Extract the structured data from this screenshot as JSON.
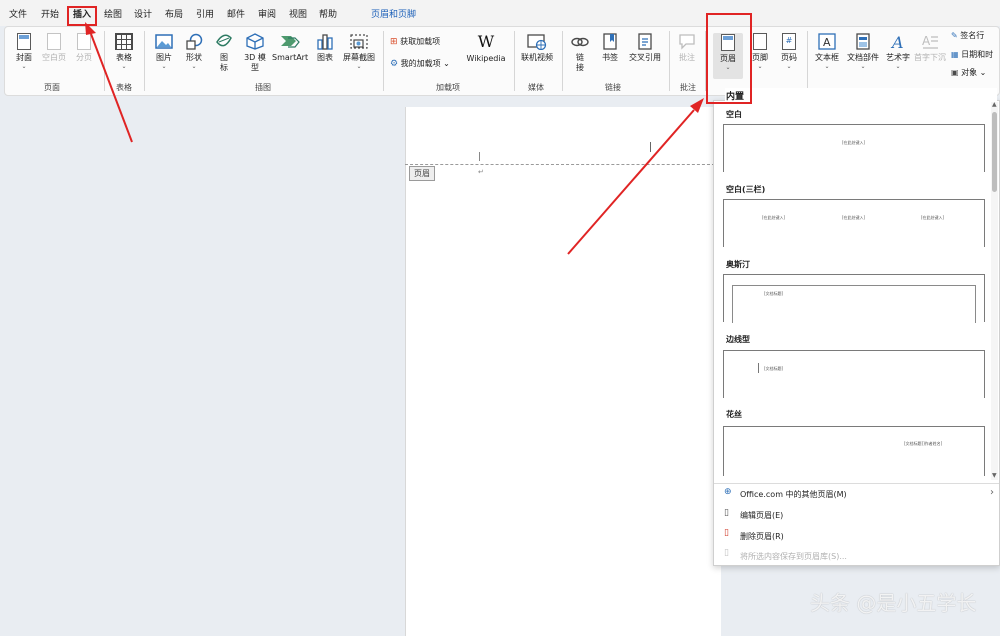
{
  "menu": {
    "tabs": [
      "文件",
      "开始",
      "插入",
      "绘图",
      "设计",
      "布局",
      "引用",
      "邮件",
      "审阅",
      "视图",
      "帮助"
    ],
    "context_tab": "页眉和页脚",
    "active_tab": "插入"
  },
  "ribbon": {
    "pages": {
      "group": "页面",
      "cover": "封面",
      "blank_page": "空白页",
      "page_break": "分页"
    },
    "tables": {
      "group": "表格",
      "table": "表格"
    },
    "illustrations": {
      "group": "插图",
      "picture": "图片",
      "shape": "形状",
      "icon_1": "图",
      "icon_2": "标",
      "model_1": "3D 模",
      "model_2": "型",
      "smartart": "SmartArt",
      "chart": "图表",
      "screenshot": "屏幕截图"
    },
    "addins": {
      "group": "加载项",
      "get_addins": "获取加载项",
      "my_addins": "我的加载项",
      "wikipedia": "Wikipedia"
    },
    "media": {
      "group": "媒体",
      "online_video": "联机视频"
    },
    "links": {
      "group": "链接",
      "link_1": "链",
      "link_2": "接",
      "bookmark": "书签",
      "cross_ref": "交叉引用"
    },
    "comments": {
      "group": "批注",
      "comment": "批注"
    },
    "header_footer": {
      "header": "页眉",
      "footer": "页脚",
      "page_number": "页码"
    },
    "text": {
      "textbox": "文本框",
      "doc_parts": "文档部件",
      "wordart": "艺术字",
      "dropcap": "首字下沉",
      "signature": "签名行",
      "datetime": "日期和时",
      "object": "对象"
    }
  },
  "document": {
    "header_tag": "页眉",
    "paragraph_mark": "↵"
  },
  "gallery": {
    "title": "内置",
    "sections": [
      {
        "name": "空白",
        "placeholders": [
          "[在此处键入]"
        ]
      },
      {
        "name": "空白(三栏)",
        "placeholders": [
          "[在此处键入]",
          "[在此处键入]",
          "[在此处键入]"
        ]
      },
      {
        "name": "奥斯汀",
        "placeholders": [
          "[文档标题]"
        ]
      },
      {
        "name": "边线型",
        "placeholders": [
          "[文档标题]"
        ]
      },
      {
        "name": "花丝",
        "placeholders": [
          "[文档标题]]作者姓名]"
        ]
      }
    ],
    "more": "Office.com 中的其他页眉(M)",
    "edit": "编辑页眉(E)",
    "remove": "删除页眉(R)",
    "save_selection": "将所选内容保存到页眉库(S)..."
  },
  "watermark": "头条 @是小五学长",
  "colors": {
    "accent": "#1a5fb4",
    "highlight": "#e02424",
    "context_tab": "#1b5fb8"
  }
}
